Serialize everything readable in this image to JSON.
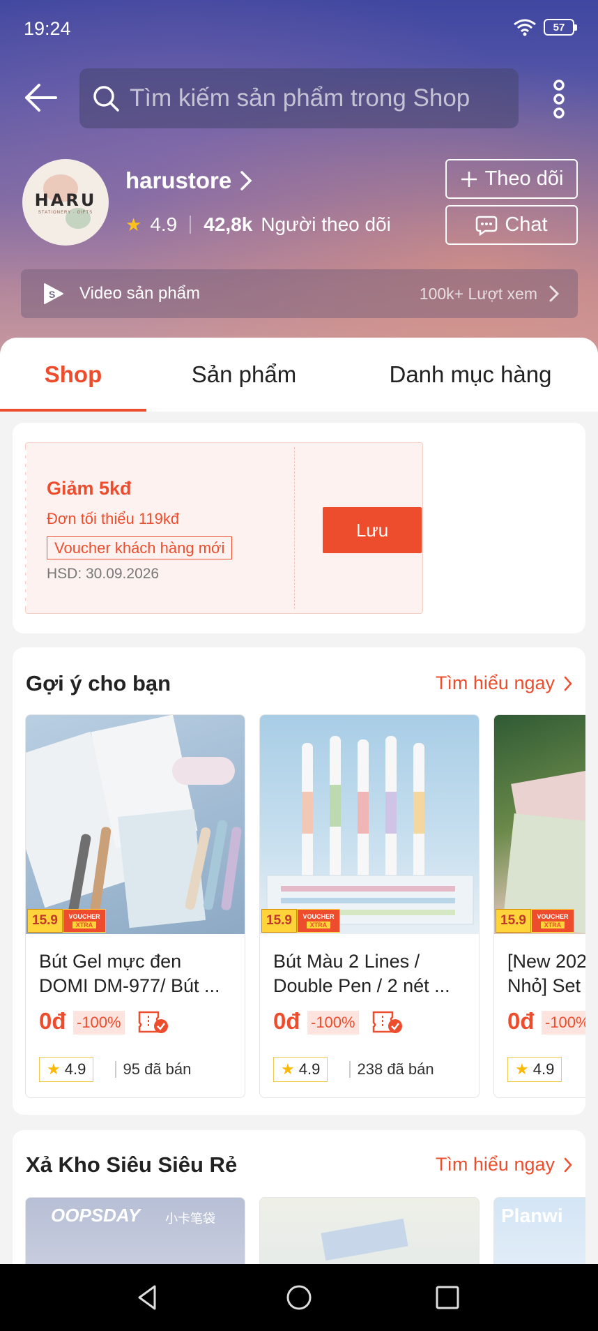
{
  "status_bar": {
    "time": "19:24",
    "battery": "57"
  },
  "search": {
    "placeholder": "Tìm kiếm sản phẩm trong Shop"
  },
  "shop": {
    "avatar_text": "HARU",
    "avatar_subtext": "STATIONERY · GIFTS",
    "name": "harustore",
    "rating": "4.9",
    "followers_count": "42,8k",
    "followers_label": "Người theo dõi",
    "follow_label": "Theo dõi",
    "chat_label": "Chat"
  },
  "video_bar": {
    "label": "Video sản phẩm",
    "views": "100k+ Lượt xem"
  },
  "tabs": [
    {
      "label": "Shop",
      "active": true
    },
    {
      "label": "Sản phẩm",
      "active": false
    },
    {
      "label": "Danh mục hàng",
      "active": false
    }
  ],
  "voucher": {
    "title": "Giảm 5kđ",
    "min_order": "Đơn tối thiểu 119kđ",
    "tag": "Voucher khách hàng mới",
    "expiry": "HSD: 30.09.2026",
    "save_label": "Lưu"
  },
  "suggest": {
    "title": "Gợi ý cho bạn",
    "link": "Tìm hiểu ngay",
    "products": [
      {
        "badge_price": "15.9",
        "badge_voucher": "VOUCHER",
        "badge_xtra": "XTRA",
        "name": "Bút Gel mực đen\nDOMI DM-977/ Bút ...",
        "price": "0đ",
        "discount": "-100%",
        "rating": "4.9",
        "sold": "95 đã bán"
      },
      {
        "badge_price": "15.9",
        "badge_voucher": "VOUCHER",
        "badge_xtra": "XTRA",
        "name": "Bút Màu 2 Lines /\nDouble Pen / 2 nét ...",
        "price": "0đ",
        "discount": "-100%",
        "rating": "4.9",
        "sold": "238 đã bán"
      },
      {
        "badge_price": "15.9",
        "badge_voucher": "VOUCHER",
        "badge_xtra": "XTRA",
        "name": "[New 202\nNhỏ] Set",
        "price": "0đ",
        "discount": "-100%",
        "rating": "4.9",
        "sold": ""
      }
    ]
  },
  "sale": {
    "title": "Xả Kho Siêu Siêu Rẻ",
    "link": "Tìm hiểu ngay",
    "thumb1_text": "OOPSDAY",
    "thumb1_sub": "小卡笔袋",
    "thumb3_text": "Planwi"
  },
  "colors": {
    "accent": "#ee4d2d",
    "star": "#ffc21c"
  }
}
